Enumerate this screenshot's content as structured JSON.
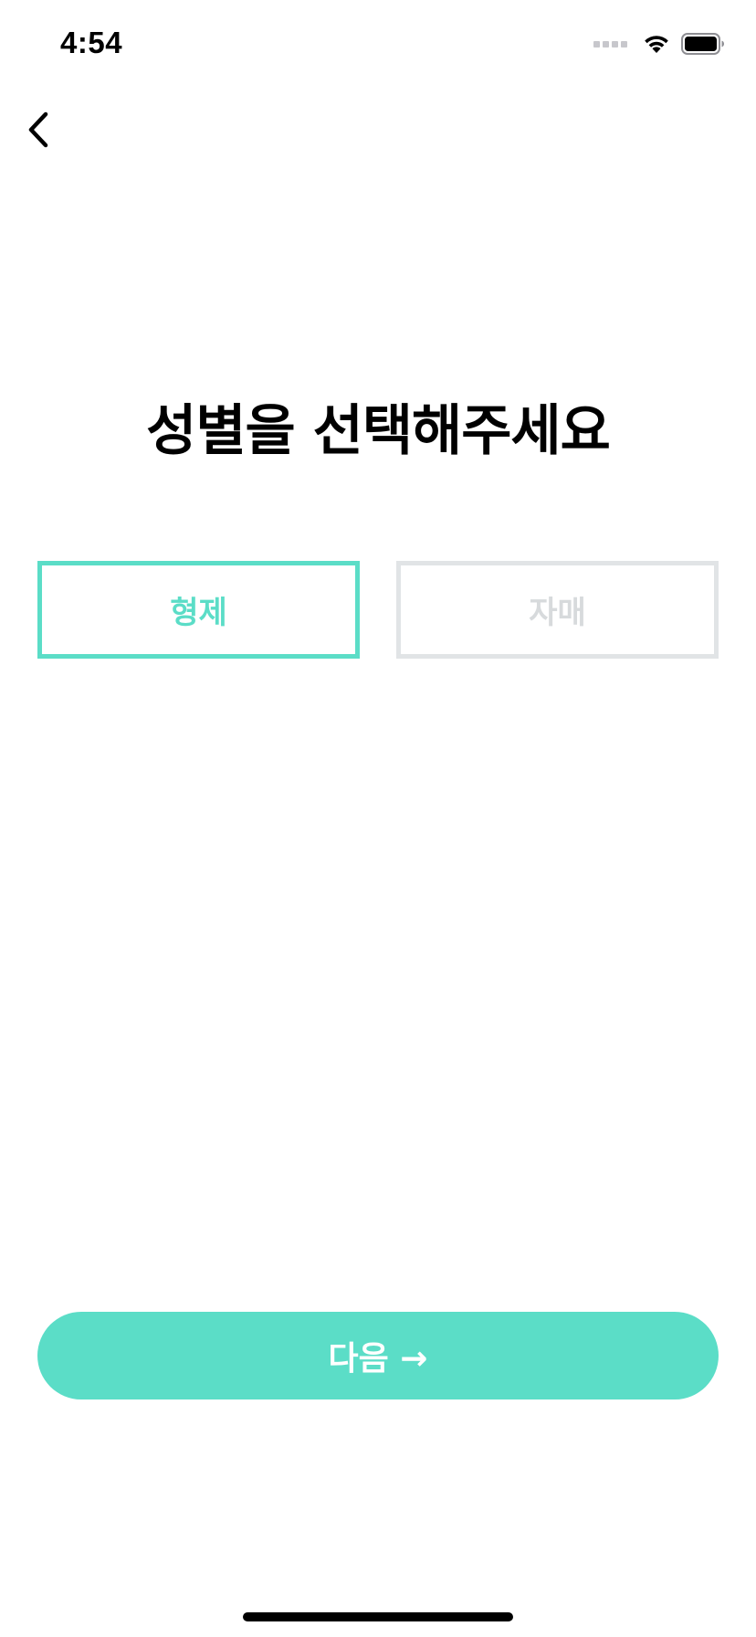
{
  "status_bar": {
    "time": "4:54",
    "icons": [
      "cellular-signal-icon",
      "wifi-icon",
      "battery-icon"
    ]
  },
  "navigation": {
    "back_icon": "chevron-left-icon"
  },
  "title": "성별을 선택해주세요",
  "options": [
    {
      "label": "형제",
      "selected": true
    },
    {
      "label": "자매",
      "selected": false
    }
  ],
  "next_button": {
    "label": "다음 →"
  },
  "colors": {
    "accent": "#5bddc7",
    "unselected_border": "#e1e4e6",
    "unselected_text": "#d7dadc",
    "background": "#ffffff",
    "text": "#000000"
  }
}
